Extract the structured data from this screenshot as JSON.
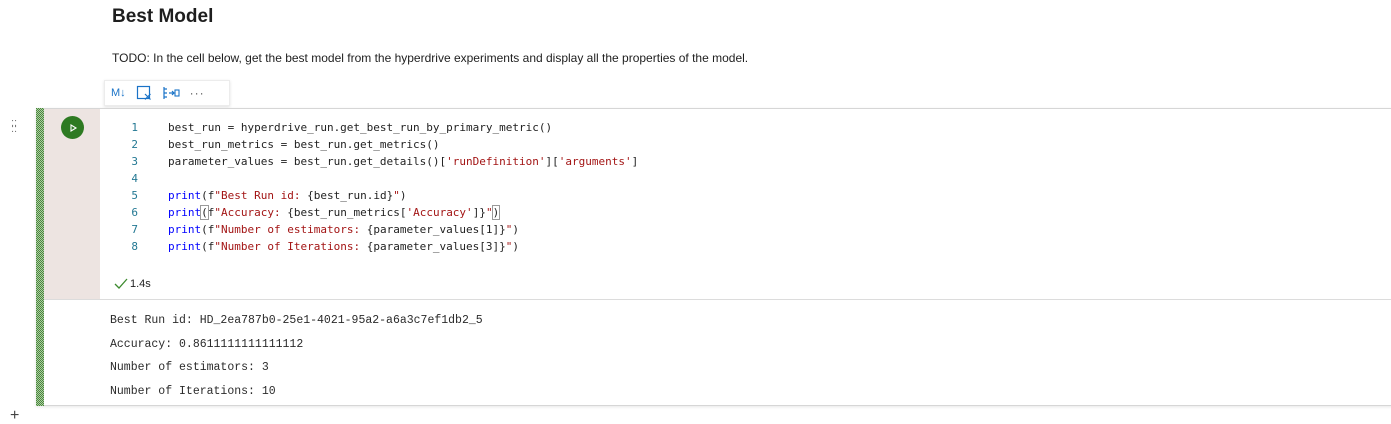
{
  "markdown": {
    "title": "Best Model",
    "paragraph": "TODO: In the cell below, get the best model from the hyperdrive experiments and display all the properties of the model."
  },
  "toolbar": {
    "items": [
      {
        "icon": "markdown-icon",
        "label": "M↓"
      },
      {
        "icon": "split-cell-icon",
        "label": ""
      },
      {
        "icon": "run-by-line-icon",
        "label": ""
      },
      {
        "icon": "more-icon",
        "label": "···"
      }
    ]
  },
  "cell": {
    "lines": [
      {
        "n": "1",
        "tokens": [
          {
            "t": "best_run = hyperdrive_run.get_best_run_by_primary_metric()",
            "c": ""
          }
        ]
      },
      {
        "n": "2",
        "tokens": [
          {
            "t": "best_run_metrics = best_run.get_metrics()",
            "c": ""
          }
        ]
      },
      {
        "n": "3",
        "tokens": [
          {
            "t": "parameter_values = best_run.get_details()[",
            "c": ""
          },
          {
            "t": "'runDefinition'",
            "c": "str"
          },
          {
            "t": "][",
            "c": ""
          },
          {
            "t": "'arguments'",
            "c": "str"
          },
          {
            "t": "]",
            "c": ""
          }
        ]
      },
      {
        "n": "4",
        "tokens": []
      },
      {
        "n": "5",
        "tokens": [
          {
            "t": "print",
            "c": "kw"
          },
          {
            "t": "(f",
            "c": ""
          },
          {
            "t": "\"Best Run id: ",
            "c": "str"
          },
          {
            "t": "{best_run.id}",
            "c": ""
          },
          {
            "t": "\"",
            "c": "str"
          },
          {
            "t": ")",
            "c": ""
          }
        ]
      },
      {
        "n": "6",
        "tokens": [
          {
            "t": "print",
            "c": "kw"
          },
          {
            "t": "(",
            "c": "hl"
          },
          {
            "t": "f",
            "c": ""
          },
          {
            "t": "\"Accuracy: ",
            "c": "str"
          },
          {
            "t": "{best_run_metrics[",
            "c": ""
          },
          {
            "t": "'Accuracy'",
            "c": "str"
          },
          {
            "t": "]}",
            "c": ""
          },
          {
            "t": "\"",
            "c": "str"
          },
          {
            "t": ")",
            "c": "hl"
          }
        ]
      },
      {
        "n": "7",
        "tokens": [
          {
            "t": "print",
            "c": "kw"
          },
          {
            "t": "(f",
            "c": ""
          },
          {
            "t": "\"Number of estimators: ",
            "c": "str"
          },
          {
            "t": "{parameter_values[1]}",
            "c": ""
          },
          {
            "t": "\"",
            "c": "str"
          },
          {
            "t": ")",
            "c": ""
          }
        ]
      },
      {
        "n": "8",
        "tokens": [
          {
            "t": "print",
            "c": "kw"
          },
          {
            "t": "(f",
            "c": ""
          },
          {
            "t": "\"Number of Iterations: ",
            "c": "str"
          },
          {
            "t": "{parameter_values[3]}",
            "c": ""
          },
          {
            "t": "\"",
            "c": "str"
          },
          {
            "t": ")",
            "c": ""
          }
        ]
      }
    ],
    "exec_time": "1.4s",
    "status_icon": "checkmark-icon"
  },
  "output": {
    "lines": [
      "Best Run id: HD_2ea787b0-25e1-4021-95a2-a6a3c7ef1db2_5",
      "Accuracy: 0.8611111111111112",
      "Number of estimators: 3",
      "Number of Iterations: 10"
    ]
  },
  "colors": {
    "keyword": "#0000ff",
    "string": "#a31515",
    "line_number": "#237893",
    "run_button": "#2e7a22",
    "gutter": "#ede4e1",
    "toolbar_icon": "#1a73c7"
  },
  "add_cell": "+"
}
